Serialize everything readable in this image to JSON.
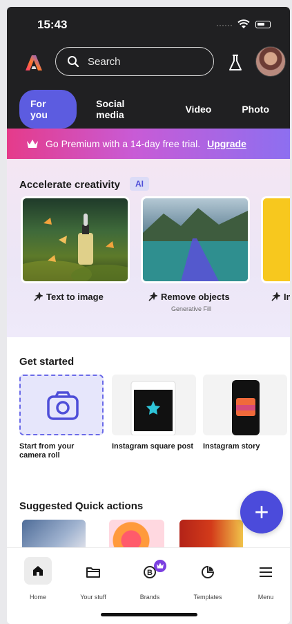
{
  "status_bar": {
    "time": "15:43"
  },
  "header": {
    "search_placeholder": "Search"
  },
  "tabs": [
    "For you",
    "Social media",
    "Video",
    "Photo"
  ],
  "banner": {
    "text": "Go Premium with a 14-day free trial.",
    "link": "Upgrade"
  },
  "accelerate": {
    "title": "Accelerate creativity",
    "badge": "AI",
    "cards": [
      {
        "label": "Text to image",
        "sub": ""
      },
      {
        "label": "Remove objects",
        "sub": "Generative Fill"
      },
      {
        "label": "In",
        "sub": ""
      }
    ]
  },
  "get_started": {
    "title": "Get started",
    "items": [
      "Start from your camera roll",
      "Instagram square post",
      "Instagram story"
    ]
  },
  "quick_actions": {
    "title": "Suggested Quick actions"
  },
  "fab": {
    "label": "+"
  },
  "nav": {
    "items": [
      "Home",
      "Your stuff",
      "Brands",
      "Templates",
      "Menu"
    ]
  },
  "colors": {
    "accent": "#5c5ce0",
    "dark_header": "#202022",
    "banner_start": "#e53b8a",
    "banner_end": "#8d6ff0"
  }
}
